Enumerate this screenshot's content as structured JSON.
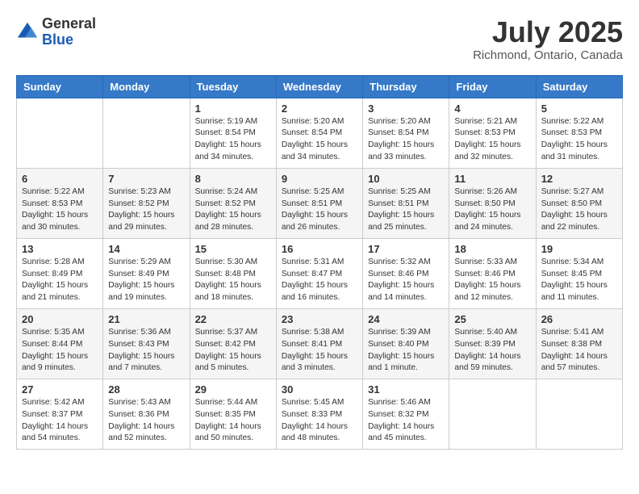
{
  "header": {
    "logo_general": "General",
    "logo_blue": "Blue",
    "month_title": "July 2025",
    "location": "Richmond, Ontario, Canada"
  },
  "weekdays": [
    "Sunday",
    "Monday",
    "Tuesday",
    "Wednesday",
    "Thursday",
    "Friday",
    "Saturday"
  ],
  "weeks": [
    [
      {
        "day": "",
        "text": ""
      },
      {
        "day": "",
        "text": ""
      },
      {
        "day": "1",
        "text": "Sunrise: 5:19 AM\nSunset: 8:54 PM\nDaylight: 15 hours and 34 minutes."
      },
      {
        "day": "2",
        "text": "Sunrise: 5:20 AM\nSunset: 8:54 PM\nDaylight: 15 hours and 34 minutes."
      },
      {
        "day": "3",
        "text": "Sunrise: 5:20 AM\nSunset: 8:54 PM\nDaylight: 15 hours and 33 minutes."
      },
      {
        "day": "4",
        "text": "Sunrise: 5:21 AM\nSunset: 8:53 PM\nDaylight: 15 hours and 32 minutes."
      },
      {
        "day": "5",
        "text": "Sunrise: 5:22 AM\nSunset: 8:53 PM\nDaylight: 15 hours and 31 minutes."
      }
    ],
    [
      {
        "day": "6",
        "text": "Sunrise: 5:22 AM\nSunset: 8:53 PM\nDaylight: 15 hours and 30 minutes."
      },
      {
        "day": "7",
        "text": "Sunrise: 5:23 AM\nSunset: 8:52 PM\nDaylight: 15 hours and 29 minutes."
      },
      {
        "day": "8",
        "text": "Sunrise: 5:24 AM\nSunset: 8:52 PM\nDaylight: 15 hours and 28 minutes."
      },
      {
        "day": "9",
        "text": "Sunrise: 5:25 AM\nSunset: 8:51 PM\nDaylight: 15 hours and 26 minutes."
      },
      {
        "day": "10",
        "text": "Sunrise: 5:25 AM\nSunset: 8:51 PM\nDaylight: 15 hours and 25 minutes."
      },
      {
        "day": "11",
        "text": "Sunrise: 5:26 AM\nSunset: 8:50 PM\nDaylight: 15 hours and 24 minutes."
      },
      {
        "day": "12",
        "text": "Sunrise: 5:27 AM\nSunset: 8:50 PM\nDaylight: 15 hours and 22 minutes."
      }
    ],
    [
      {
        "day": "13",
        "text": "Sunrise: 5:28 AM\nSunset: 8:49 PM\nDaylight: 15 hours and 21 minutes."
      },
      {
        "day": "14",
        "text": "Sunrise: 5:29 AM\nSunset: 8:49 PM\nDaylight: 15 hours and 19 minutes."
      },
      {
        "day": "15",
        "text": "Sunrise: 5:30 AM\nSunset: 8:48 PM\nDaylight: 15 hours and 18 minutes."
      },
      {
        "day": "16",
        "text": "Sunrise: 5:31 AM\nSunset: 8:47 PM\nDaylight: 15 hours and 16 minutes."
      },
      {
        "day": "17",
        "text": "Sunrise: 5:32 AM\nSunset: 8:46 PM\nDaylight: 15 hours and 14 minutes."
      },
      {
        "day": "18",
        "text": "Sunrise: 5:33 AM\nSunset: 8:46 PM\nDaylight: 15 hours and 12 minutes."
      },
      {
        "day": "19",
        "text": "Sunrise: 5:34 AM\nSunset: 8:45 PM\nDaylight: 15 hours and 11 minutes."
      }
    ],
    [
      {
        "day": "20",
        "text": "Sunrise: 5:35 AM\nSunset: 8:44 PM\nDaylight: 15 hours and 9 minutes."
      },
      {
        "day": "21",
        "text": "Sunrise: 5:36 AM\nSunset: 8:43 PM\nDaylight: 15 hours and 7 minutes."
      },
      {
        "day": "22",
        "text": "Sunrise: 5:37 AM\nSunset: 8:42 PM\nDaylight: 15 hours and 5 minutes."
      },
      {
        "day": "23",
        "text": "Sunrise: 5:38 AM\nSunset: 8:41 PM\nDaylight: 15 hours and 3 minutes."
      },
      {
        "day": "24",
        "text": "Sunrise: 5:39 AM\nSunset: 8:40 PM\nDaylight: 15 hours and 1 minute."
      },
      {
        "day": "25",
        "text": "Sunrise: 5:40 AM\nSunset: 8:39 PM\nDaylight: 14 hours and 59 minutes."
      },
      {
        "day": "26",
        "text": "Sunrise: 5:41 AM\nSunset: 8:38 PM\nDaylight: 14 hours and 57 minutes."
      }
    ],
    [
      {
        "day": "27",
        "text": "Sunrise: 5:42 AM\nSunset: 8:37 PM\nDaylight: 14 hours and 54 minutes."
      },
      {
        "day": "28",
        "text": "Sunrise: 5:43 AM\nSunset: 8:36 PM\nDaylight: 14 hours and 52 minutes."
      },
      {
        "day": "29",
        "text": "Sunrise: 5:44 AM\nSunset: 8:35 PM\nDaylight: 14 hours and 50 minutes."
      },
      {
        "day": "30",
        "text": "Sunrise: 5:45 AM\nSunset: 8:33 PM\nDaylight: 14 hours and 48 minutes."
      },
      {
        "day": "31",
        "text": "Sunrise: 5:46 AM\nSunset: 8:32 PM\nDaylight: 14 hours and 45 minutes."
      },
      {
        "day": "",
        "text": ""
      },
      {
        "day": "",
        "text": ""
      }
    ]
  ]
}
